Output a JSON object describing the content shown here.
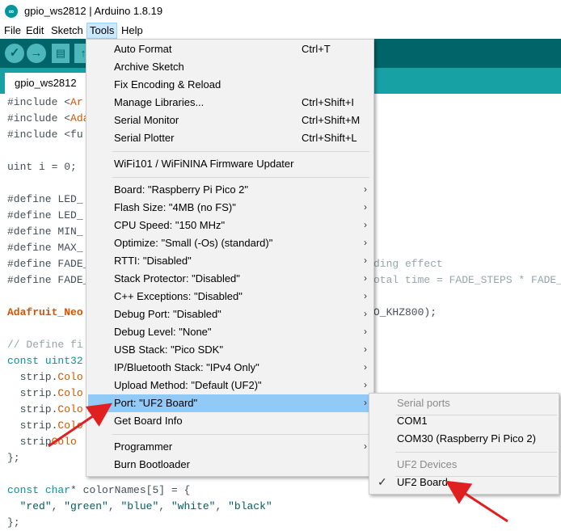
{
  "window": {
    "title": "gpio_ws2812 | Arduino 1.8.19",
    "logo": "arduino-logo-icon"
  },
  "menubar": [
    "File",
    "Edit",
    "Sketch",
    "Tools",
    "Help"
  ],
  "toolbar": {
    "icons": [
      "verify-icon",
      "upload-icon",
      "new-icon",
      "open-icon"
    ],
    "color": "#006468"
  },
  "tab": {
    "label": "gpio_ws2812"
  },
  "code": {
    "l1a": "#include <",
    "l1b": "Ar",
    "l2a": "#include <",
    "l2b": "Ada",
    "l3a": "#include <",
    "l3b": "fu",
    "l4": "uint i = 0;",
    "l5": "#define LED_",
    "l6": "#define LED_",
    "l7": "#define MIN_",
    "l8": "#define MAX_",
    "l9": "#define FADE_",
    "l9r": "ding effect",
    "l10": "#define FADE_",
    "l10r": "otal time = FADE_STEPS * FADE_",
    "l11": "Adafruit_Neo",
    "l11r": "O_KHZ800);",
    "l12": "// Define fi",
    "l13a": "const",
    "l13b": "uint32",
    "l14a": "  strip.",
    "l14b": "Colo",
    "l15a": "  strip.",
    "l15b": "Colo",
    "l16a": "  strip.",
    "l16b": "Colo",
    "l17a": "  strip.",
    "l17b": "Colo",
    "l18a": "  strip",
    "l18b": "Colo",
    "l19": "};",
    "l20a": "const",
    "l20b": "char",
    "l20c": "* colorNames[5] = {",
    "l21a": "  ",
    "l21b": "\"red\"",
    "l21c": ", ",
    "l21d": "\"green\"",
    "l21e": ", ",
    "l21f": "\"blue\"",
    "l21g": ", ",
    "l21h": "\"white\"",
    "l21i": ", ",
    "l21j": "\"black\"",
    "l22": "};"
  },
  "tools_menu": {
    "items": [
      {
        "label": "Auto Format",
        "shortcut": "Ctrl+T"
      },
      {
        "label": "Archive Sketch",
        "shortcut": ""
      },
      {
        "label": "Fix Encoding & Reload",
        "shortcut": ""
      },
      {
        "label": "Manage Libraries...",
        "shortcut": "Ctrl+Shift+I"
      },
      {
        "label": "Serial Monitor",
        "shortcut": "Ctrl+Shift+M"
      },
      {
        "label": "Serial Plotter",
        "shortcut": "Ctrl+Shift+L"
      },
      {
        "label": "WiFi101 / WiFiNINA Firmware Updater",
        "shortcut": ""
      },
      {
        "label": "Board: \"Raspberry Pi Pico 2\"",
        "shortcut": ""
      },
      {
        "label": "Flash Size: \"4MB (no FS)\"",
        "shortcut": ""
      },
      {
        "label": "CPU Speed: \"150 MHz\"",
        "shortcut": ""
      },
      {
        "label": "Optimize: \"Small (-Os) (standard)\"",
        "shortcut": ""
      },
      {
        "label": "RTTI: \"Disabled\"",
        "shortcut": ""
      },
      {
        "label": "Stack Protector: \"Disabled\"",
        "shortcut": ""
      },
      {
        "label": "C++ Exceptions: \"Disabled\"",
        "shortcut": ""
      },
      {
        "label": "Debug Port: \"Disabled\"",
        "shortcut": ""
      },
      {
        "label": "Debug Level: \"None\"",
        "shortcut": ""
      },
      {
        "label": "USB Stack: \"Pico SDK\"",
        "shortcut": ""
      },
      {
        "label": "IP/Bluetooth Stack: \"IPv4 Only\"",
        "shortcut": ""
      },
      {
        "label": "Upload Method: \"Default (UF2)\"",
        "shortcut": ""
      },
      {
        "label": "Port: \"UF2 Board\"",
        "shortcut": ""
      },
      {
        "label": "Get Board Info",
        "shortcut": ""
      },
      {
        "label": "Programmer",
        "shortcut": ""
      },
      {
        "label": "Burn Bootloader",
        "shortcut": ""
      }
    ],
    "arrow": "›"
  },
  "port_submenu": {
    "header_serial": "Serial ports",
    "com1": "COM1",
    "com30": "COM30 (Raspberry Pi Pico 2)",
    "header_uf2": "UF2 Devices",
    "uf2": "UF2 Board",
    "check": "✓"
  },
  "annotation_color": "#e02020"
}
